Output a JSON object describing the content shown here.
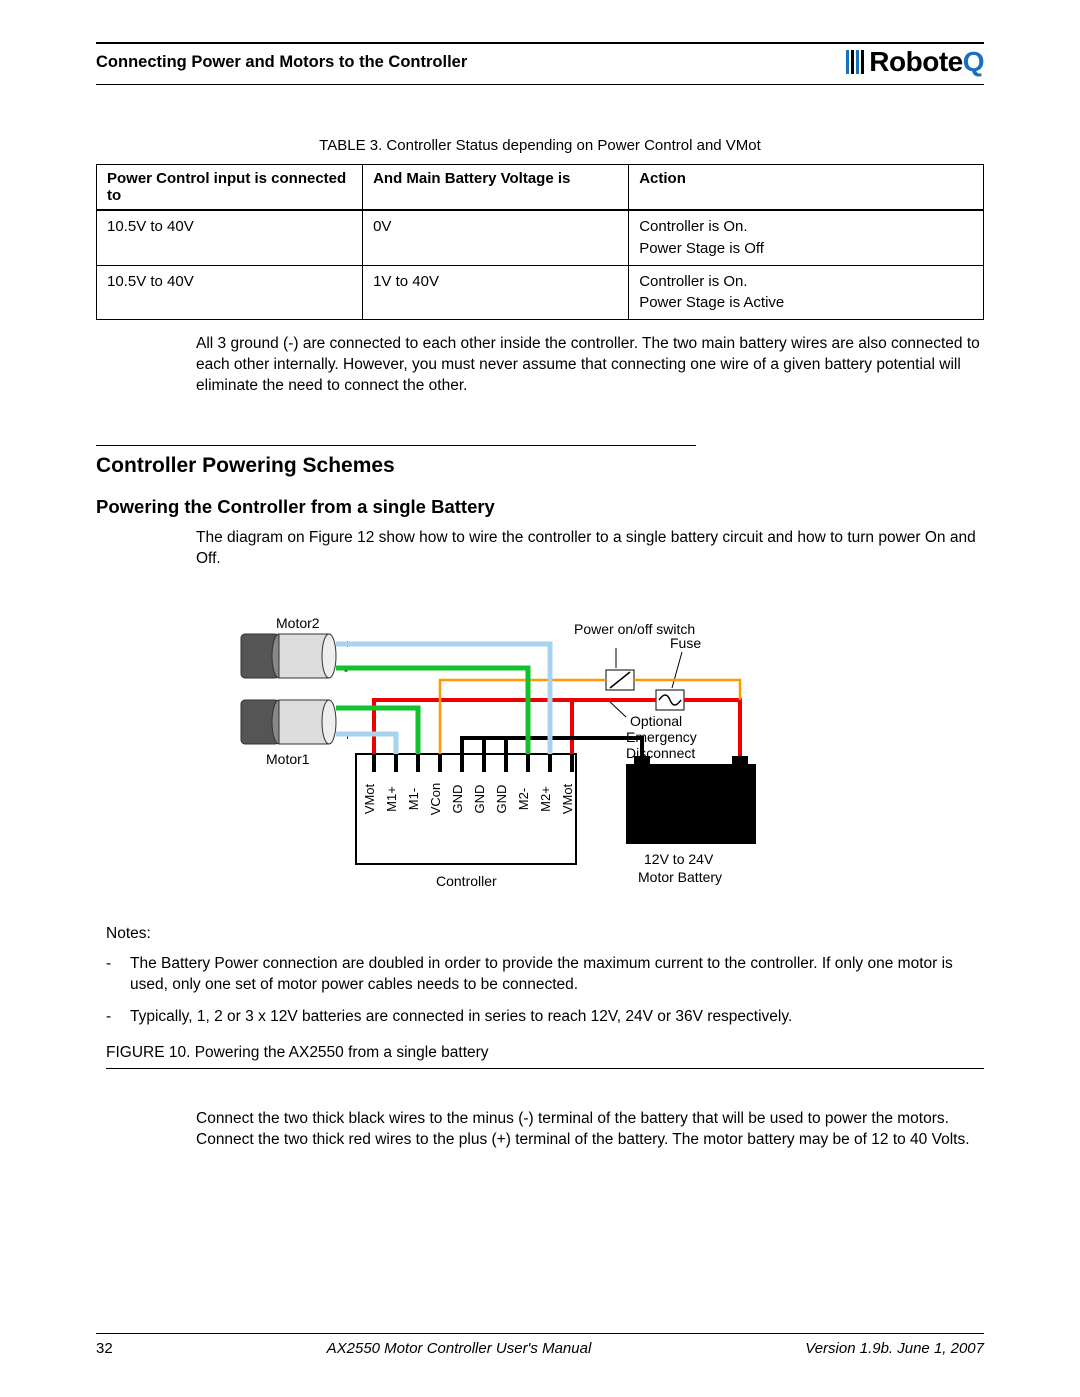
{
  "header": {
    "title": "Connecting Power and Motors to the Controller",
    "logo_text": "Robote",
    "logo_q": "Q"
  },
  "table": {
    "caption": "TABLE 3. Controller Status depending on Power Control and VMot",
    "headers": {
      "a": "Power Control input is connected to",
      "b": "And Main Battery Voltage is",
      "c": "Action"
    },
    "rows": [
      {
        "a": "10.5V to 40V",
        "b": "0V",
        "c1": "Controller is On.",
        "c2": "Power Stage is Off"
      },
      {
        "a": "10.5V to 40V",
        "b": "1V to 40V",
        "c1": "Controller is On.",
        "c2": "Power Stage is Active"
      }
    ]
  },
  "ground_note": "All 3 ground (-) are connected to each other inside the controller. The two main battery wires are also connected to each other internally. However, you must never assume that connecting one wire of a given battery potential will eliminate the need to connect the other.",
  "section": {
    "title": "Controller Powering Schemes",
    "subtitle": "Powering the Controller from a single Battery",
    "intro": "The diagram on Figure 12 show how to wire the controller to a single battery circuit and how to turn power On and Off."
  },
  "diagram": {
    "motor2": "Motor2",
    "motor1": "Motor1",
    "switch": "Power on/off switch",
    "fuse": "Fuse",
    "disconnect_l1": "Optional",
    "disconnect_l2": "Emergency",
    "disconnect_l3": "Disconnect",
    "battery_l1": "12V to 24V",
    "battery_l2": "Motor Battery",
    "controller": "Controller",
    "terminals": [
      "VMot",
      "M1+",
      "M1-",
      "VCon",
      "GND",
      "GND",
      "GND",
      "M2-",
      "M2+",
      "VMot"
    ]
  },
  "notes": {
    "label": "Notes:",
    "items": [
      "The Battery Power connection are doubled in order to provide the maximum current to the controller. If only one motor is used, only one set of motor power cables needs to be connected.",
      "Typically, 1, 2 or 3 x 12V batteries are connected in series to reach 12V, 24V or 36V respectively."
    ]
  },
  "figure_caption": "FIGURE 10.  Powering the AX2550 from a single battery",
  "connect_para": "Connect the two thick black wires to the minus (-) terminal of the battery that will be used to power the motors. Connect the two thick red wires to the plus (+) terminal of the battery. The motor battery may be of 12 to 40 Volts.",
  "footer": {
    "page": "32",
    "manual": "AX2550 Motor Controller User's Manual",
    "version": "Version 1.9b. June 1, 2007"
  }
}
